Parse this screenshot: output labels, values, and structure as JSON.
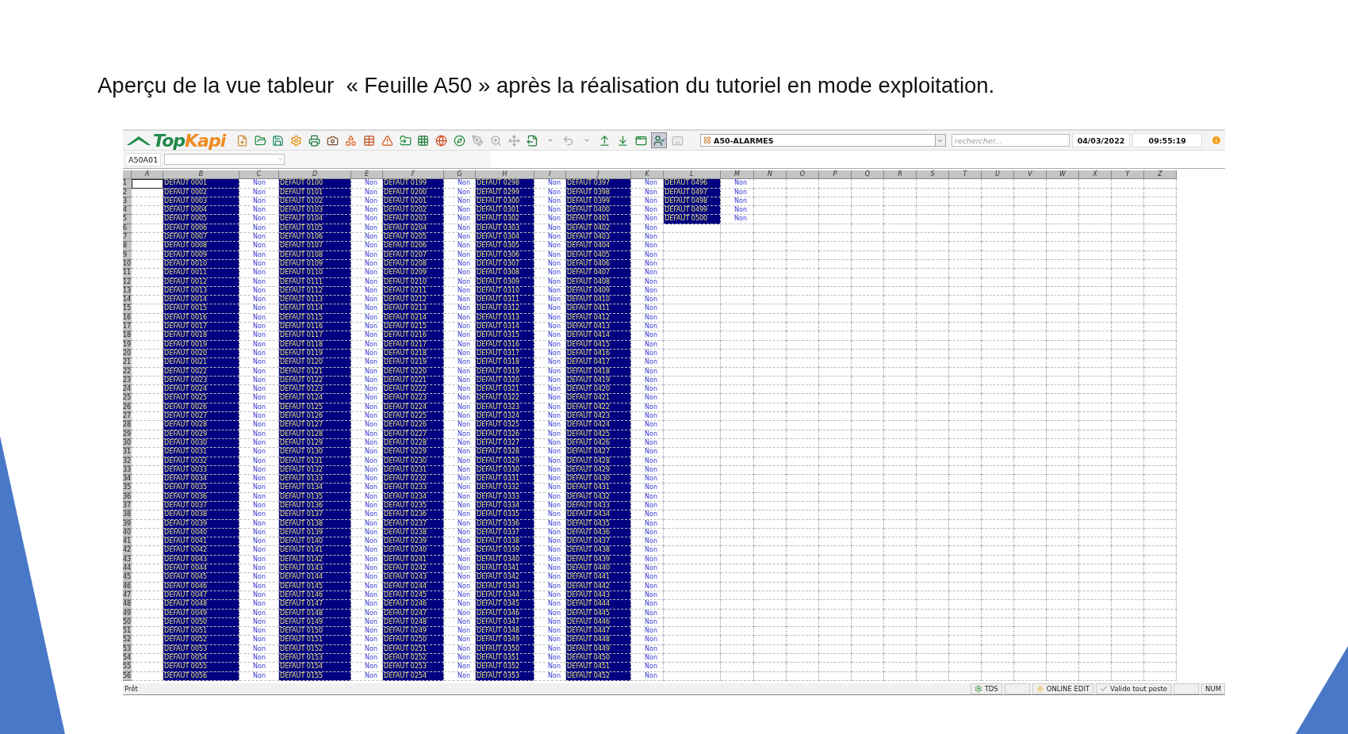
{
  "slide": {
    "caption": "Aperçu de la vue tableur  « Feuille A50 » après la réalisation du tutoriel en mode exploitation."
  },
  "app": {
    "logo": {
      "part_1": "Top",
      "part_2": "Kapi"
    },
    "view_select": "A50-ALARMES",
    "search": {
      "placeholder": "rechercher..."
    },
    "date": "04/03/2022",
    "time": "09:55:19",
    "name_box": "A50A01"
  },
  "sheet": {
    "columns": [
      {
        "label": "A"
      },
      {
        "label": "B",
        "kind": "alarm"
      },
      {
        "label": "C",
        "kind": "state"
      },
      {
        "label": "D",
        "kind": "alarm"
      },
      {
        "label": "E",
        "kind": "state"
      },
      {
        "label": "F",
        "kind": "alarm"
      },
      {
        "label": "G",
        "kind": "state"
      },
      {
        "label": "H",
        "kind": "alarm"
      },
      {
        "label": "I",
        "kind": "state"
      },
      {
        "label": "J",
        "kind": "alarm"
      },
      {
        "label": "K",
        "kind": "state"
      },
      {
        "label": "L",
        "kind": "alarm"
      },
      {
        "label": "M",
        "kind": "state"
      },
      {
        "label": "N"
      },
      {
        "label": "O"
      },
      {
        "label": "P"
      },
      {
        "label": "Q"
      },
      {
        "label": "R"
      },
      {
        "label": "S"
      },
      {
        "label": "T"
      },
      {
        "label": "U"
      },
      {
        "label": "V"
      },
      {
        "label": "W"
      },
      {
        "label": "X"
      },
      {
        "label": "Y"
      },
      {
        "label": "Z"
      }
    ],
    "rows": [
      {
        "n": "1",
        "selected": true,
        "cells": [
          "",
          "DEFAUT 0001",
          "Non",
          "DEFAUT 0100",
          "Non",
          "DEFAUT 0199",
          "Non",
          "DEFAUT 0298",
          "Non",
          "DEFAUT 0397",
          "Non",
          "DEFAUT 0496",
          "Non"
        ]
      },
      {
        "n": "2",
        "selected": false,
        "cells": [
          "",
          "DEFAUT 0002",
          "Non",
          "DEFAUT 0101",
          "Non",
          "DEFAUT 0200",
          "Non",
          "DEFAUT 0299",
          "Non",
          "DEFAUT 0398",
          "Non",
          "DEFAUT 0497",
          "Non"
        ]
      },
      {
        "n": "3",
        "selected": false,
        "cells": [
          "",
          "DEFAUT 0003",
          "Non",
          "DEFAUT 0102",
          "Non",
          "DEFAUT 0201",
          "Non",
          "DEFAUT 0300",
          "Non",
          "DEFAUT 0399",
          "Non",
          "DEFAUT 0498",
          "Non"
        ]
      },
      {
        "n": "4",
        "selected": false,
        "cells": [
          "",
          "DEFAUT 0004",
          "Non",
          "DEFAUT 0103",
          "Non",
          "DEFAUT 0202",
          "Non",
          "DEFAUT 0301",
          "Non",
          "DEFAUT 0400",
          "Non",
          "DEFAUT 0499",
          "Non"
        ]
      },
      {
        "n": "5",
        "selected": false,
        "cells": [
          "",
          "DEFAUT 0005",
          "Non",
          "DEFAUT 0104",
          "Non",
          "DEFAUT 0203",
          "Non",
          "DEFAUT 0302",
          "Non",
          "DEFAUT 0401",
          "Non",
          "DEFAUT 0500",
          "Non"
        ]
      },
      {
        "n": "6",
        "selected": false,
        "cells": [
          "",
          "DEFAUT 0006",
          "Non",
          "DEFAUT 0105",
          "Non",
          "DEFAUT 0204",
          "Non",
          "DEFAUT 0303",
          "Non",
          "DEFAUT 0402",
          "Non"
        ]
      },
      {
        "n": "7",
        "selected": false,
        "cells": [
          "",
          "DEFAUT 0007",
          "Non",
          "DEFAUT 0106",
          "Non",
          "DEFAUT 0205",
          "Non",
          "DEFAUT 0304",
          "Non",
          "DEFAUT 0403",
          "Non"
        ]
      },
      {
        "n": "8",
        "selected": false,
        "cells": [
          "",
          "DEFAUT 0008",
          "Non",
          "DEFAUT 0107",
          "Non",
          "DEFAUT 0206",
          "Non",
          "DEFAUT 0305",
          "Non",
          "DEFAUT 0404",
          "Non"
        ]
      },
      {
        "n": "9",
        "selected": false,
        "cells": [
          "",
          "DEFAUT 0009",
          "Non",
          "DEFAUT 0108",
          "Non",
          "DEFAUT 0207",
          "Non",
          "DEFAUT 0306",
          "Non",
          "DEFAUT 0405",
          "Non"
        ]
      },
      {
        "n": "10",
        "selected": false,
        "cells": [
          "",
          "DEFAUT 0010",
          "Non",
          "DEFAUT 0109",
          "Non",
          "DEFAUT 0208",
          "Non",
          "DEFAUT 0307",
          "Non",
          "DEFAUT 0406",
          "Non"
        ]
      },
      {
        "n": "11",
        "selected": false,
        "cells": [
          "",
          "DEFAUT 0011",
          "Non",
          "DEFAUT 0110",
          "Non",
          "DEFAUT 0209",
          "Non",
          "DEFAUT 0308",
          "Non",
          "DEFAUT 0407",
          "Non"
        ]
      },
      {
        "n": "12",
        "selected": false,
        "cells": [
          "",
          "DEFAUT 0012",
          "Non",
          "DEFAUT 0111",
          "Non",
          "DEFAUT 0210",
          "Non",
          "DEFAUT 0309",
          "Non",
          "DEFAUT 0408",
          "Non"
        ]
      },
      {
        "n": "13",
        "selected": false,
        "cells": [
          "",
          "DEFAUT 0013",
          "Non",
          "DEFAUT 0112",
          "Non",
          "DEFAUT 0211",
          "Non",
          "DEFAUT 0310",
          "Non",
          "DEFAUT 0409",
          "Non"
        ]
      },
      {
        "n": "14",
        "selected": false,
        "cells": [
          "",
          "DEFAUT 0014",
          "Non",
          "DEFAUT 0113",
          "Non",
          "DEFAUT 0212",
          "Non",
          "DEFAUT 0311",
          "Non",
          "DEFAUT 0410",
          "Non"
        ]
      },
      {
        "n": "15",
        "selected": false,
        "cells": [
          "",
          "DEFAUT 0015",
          "Non",
          "DEFAUT 0114",
          "Non",
          "DEFAUT 0213",
          "Non",
          "DEFAUT 0312",
          "Non",
          "DEFAUT 0411",
          "Non"
        ]
      },
      {
        "n": "16",
        "selected": false,
        "cells": [
          "",
          "DEFAUT 0016",
          "Non",
          "DEFAUT 0115",
          "Non",
          "DEFAUT 0214",
          "Non",
          "DEFAUT 0313",
          "Non",
          "DEFAUT 0412",
          "Non"
        ]
      },
      {
        "n": "17",
        "selected": false,
        "cells": [
          "",
          "DEFAUT 0017",
          "Non",
          "DEFAUT 0116",
          "Non",
          "DEFAUT 0215",
          "Non",
          "DEFAUT 0314",
          "Non",
          "DEFAUT 0413",
          "Non"
        ]
      },
      {
        "n": "18",
        "selected": false,
        "cells": [
          "",
          "DEFAUT 0018",
          "Non",
          "DEFAUT 0117",
          "Non",
          "DEFAUT 0216",
          "Non",
          "DEFAUT 0315",
          "Non",
          "DEFAUT 0414",
          "Non"
        ]
      },
      {
        "n": "19",
        "selected": false,
        "cells": [
          "",
          "DEFAUT 0019",
          "Non",
          "DEFAUT 0118",
          "Non",
          "DEFAUT 0217",
          "Non",
          "DEFAUT 0316",
          "Non",
          "DEFAUT 0415",
          "Non"
        ]
      },
      {
        "n": "20",
        "selected": false,
        "cells": [
          "",
          "DEFAUT 0020",
          "Non",
          "DEFAUT 0119",
          "Non",
          "DEFAUT 0218",
          "Non",
          "DEFAUT 0317",
          "Non",
          "DEFAUT 0416",
          "Non"
        ]
      },
      {
        "n": "21",
        "selected": false,
        "cells": [
          "",
          "DEFAUT 0021",
          "Non",
          "DEFAUT 0120",
          "Non",
          "DEFAUT 0219",
          "Non",
          "DEFAUT 0318",
          "Non",
          "DEFAUT 0417",
          "Non"
        ]
      },
      {
        "n": "22",
        "selected": false,
        "cells": [
          "",
          "DEFAUT 0022",
          "Non",
          "DEFAUT 0121",
          "Non",
          "DEFAUT 0220",
          "Non",
          "DEFAUT 0319",
          "Non",
          "DEFAUT 0418",
          "Non"
        ]
      },
      {
        "n": "23",
        "selected": false,
        "cells": [
          "",
          "DEFAUT 0023",
          "Non",
          "DEFAUT 0122",
          "Non",
          "DEFAUT 0221",
          "Non",
          "DEFAUT 0320",
          "Non",
          "DEFAUT 0419",
          "Non"
        ]
      },
      {
        "n": "24",
        "selected": false,
        "cells": [
          "",
          "DEFAUT 0024",
          "Non",
          "DEFAUT 0123",
          "Non",
          "DEFAUT 0222",
          "Non",
          "DEFAUT 0321",
          "Non",
          "DEFAUT 0420",
          "Non"
        ]
      },
      {
        "n": "25",
        "selected": false,
        "cells": [
          "",
          "DEFAUT 0025",
          "Non",
          "DEFAUT 0124",
          "Non",
          "DEFAUT 0223",
          "Non",
          "DEFAUT 0322",
          "Non",
          "DEFAUT 0421",
          "Non"
        ]
      },
      {
        "n": "26",
        "selected": false,
        "cells": [
          "",
          "DEFAUT 0026",
          "Non",
          "DEFAUT 0125",
          "Non",
          "DEFAUT 0224",
          "Non",
          "DEFAUT 0323",
          "Non",
          "DEFAUT 0422",
          "Non"
        ]
      },
      {
        "n": "27",
        "selected": false,
        "cells": [
          "",
          "DEFAUT 0027",
          "Non",
          "DEFAUT 0126",
          "Non",
          "DEFAUT 0225",
          "Non",
          "DEFAUT 0324",
          "Non",
          "DEFAUT 0423",
          "Non"
        ]
      },
      {
        "n": "28",
        "selected": false,
        "cells": [
          "",
          "DEFAUT 0028",
          "Non",
          "DEFAUT 0127",
          "Non",
          "DEFAUT 0226",
          "Non",
          "DEFAUT 0325",
          "Non",
          "DEFAUT 0424",
          "Non"
        ]
      },
      {
        "n": "29",
        "selected": false,
        "cells": [
          "",
          "DEFAUT 0029",
          "Non",
          "DEFAUT 0128",
          "Non",
          "DEFAUT 0227",
          "Non",
          "DEFAUT 0326",
          "Non",
          "DEFAUT 0425",
          "Non"
        ]
      },
      {
        "n": "30",
        "selected": false,
        "cells": [
          "",
          "DEFAUT 0030",
          "Non",
          "DEFAUT 0129",
          "Non",
          "DEFAUT 0228",
          "Non",
          "DEFAUT 0327",
          "Non",
          "DEFAUT 0426",
          "Non"
        ]
      },
      {
        "n": "31",
        "selected": false,
        "cells": [
          "",
          "DEFAUT 0031",
          "Non",
          "DEFAUT 0130",
          "Non",
          "DEFAUT 0229",
          "Non",
          "DEFAUT 0328",
          "Non",
          "DEFAUT 0427",
          "Non"
        ]
      },
      {
        "n": "32",
        "selected": false,
        "cells": [
          "",
          "DEFAUT 0032",
          "Non",
          "DEFAUT 0131",
          "Non",
          "DEFAUT 0230",
          "Non",
          "DEFAUT 0329",
          "Non",
          "DEFAUT 0428",
          "Non"
        ]
      },
      {
        "n": "33",
        "selected": false,
        "cells": [
          "",
          "DEFAUT 0033",
          "Non",
          "DEFAUT 0132",
          "Non",
          "DEFAUT 0231",
          "Non",
          "DEFAUT 0330",
          "Non",
          "DEFAUT 0429",
          "Non"
        ]
      },
      {
        "n": "34",
        "selected": false,
        "cells": [
          "",
          "DEFAUT 0034",
          "Non",
          "DEFAUT 0133",
          "Non",
          "DEFAUT 0232",
          "Non",
          "DEFAUT 0331",
          "Non",
          "DEFAUT 0430",
          "Non"
        ]
      },
      {
        "n": "35",
        "selected": false,
        "cells": [
          "",
          "DEFAUT 0035",
          "Non",
          "DEFAUT 0134",
          "Non",
          "DEFAUT 0233",
          "Non",
          "DEFAUT 0332",
          "Non",
          "DEFAUT 0431",
          "Non"
        ]
      },
      {
        "n": "36",
        "selected": false,
        "cells": [
          "",
          "DEFAUT 0036",
          "Non",
          "DEFAUT 0135",
          "Non",
          "DEFAUT 0234",
          "Non",
          "DEFAUT 0333",
          "Non",
          "DEFAUT 0432",
          "Non"
        ]
      },
      {
        "n": "37",
        "selected": false,
        "cells": [
          "",
          "DEFAUT 0037",
          "Non",
          "DEFAUT 0136",
          "Non",
          "DEFAUT 0235",
          "Non",
          "DEFAUT 0334",
          "Non",
          "DEFAUT 0433",
          "Non"
        ]
      },
      {
        "n": "38",
        "selected": false,
        "cells": [
          "",
          "DEFAUT 0038",
          "Non",
          "DEFAUT 0137",
          "Non",
          "DEFAUT 0236",
          "Non",
          "DEFAUT 0335",
          "Non",
          "DEFAUT 0434",
          "Non"
        ]
      },
      {
        "n": "39",
        "selected": false,
        "cells": [
          "",
          "DEFAUT 0039",
          "Non",
          "DEFAUT 0138",
          "Non",
          "DEFAUT 0237",
          "Non",
          "DEFAUT 0336",
          "Non",
          "DEFAUT 0435",
          "Non"
        ]
      },
      {
        "n": "40",
        "selected": false,
        "cells": [
          "",
          "DEFAUT 0040",
          "Non",
          "DEFAUT 0139",
          "Non",
          "DEFAUT 0238",
          "Non",
          "DEFAUT 0337",
          "Non",
          "DEFAUT 0436",
          "Non"
        ]
      },
      {
        "n": "41",
        "selected": false,
        "cells": [
          "",
          "DEFAUT 0041",
          "Non",
          "DEFAUT 0140",
          "Non",
          "DEFAUT 0239",
          "Non",
          "DEFAUT 0338",
          "Non",
          "DEFAUT 0437",
          "Non"
        ]
      },
      {
        "n": "42",
        "selected": false,
        "cells": [
          "",
          "DEFAUT 0042",
          "Non",
          "DEFAUT 0141",
          "Non",
          "DEFAUT 0240",
          "Non",
          "DEFAUT 0339",
          "Non",
          "DEFAUT 0438",
          "Non"
        ]
      },
      {
        "n": "43",
        "selected": false,
        "cells": [
          "",
          "DEFAUT 0043",
          "Non",
          "DEFAUT 0142",
          "Non",
          "DEFAUT 0241",
          "Non",
          "DEFAUT 0340",
          "Non",
          "DEFAUT 0439",
          "Non"
        ]
      },
      {
        "n": "44",
        "selected": false,
        "cells": [
          "",
          "DEFAUT 0044",
          "Non",
          "DEFAUT 0143",
          "Non",
          "DEFAUT 0242",
          "Non",
          "DEFAUT 0341",
          "Non",
          "DEFAUT 0440",
          "Non"
        ]
      },
      {
        "n": "45",
        "selected": false,
        "cells": [
          "",
          "DEFAUT 0045",
          "Non",
          "DEFAUT 0144",
          "Non",
          "DEFAUT 0243",
          "Non",
          "DEFAUT 0342",
          "Non",
          "DEFAUT 0441",
          "Non"
        ]
      },
      {
        "n": "46",
        "selected": false,
        "cells": [
          "",
          "DEFAUT 0046",
          "Non",
          "DEFAUT 0145",
          "Non",
          "DEFAUT 0244",
          "Non",
          "DEFAUT 0343",
          "Non",
          "DEFAUT 0442",
          "Non"
        ]
      },
      {
        "n": "47",
        "selected": false,
        "cells": [
          "",
          "DEFAUT 0047",
          "Non",
          "DEFAUT 0146",
          "Non",
          "DEFAUT 0245",
          "Non",
          "DEFAUT 0344",
          "Non",
          "DEFAUT 0443",
          "Non"
        ]
      },
      {
        "n": "48",
        "selected": false,
        "cells": [
          "",
          "DEFAUT 0048",
          "Non",
          "DEFAUT 0147",
          "Non",
          "DEFAUT 0246",
          "Non",
          "DEFAUT 0345",
          "Non",
          "DEFAUT 0444",
          "Non"
        ]
      },
      {
        "n": "49",
        "selected": false,
        "cells": [
          "",
          "DEFAUT 0049",
          "Non",
          "DEFAUT 0148",
          "Non",
          "DEFAUT 0247",
          "Non",
          "DEFAUT 0346",
          "Non",
          "DEFAUT 0445",
          "Non"
        ]
      },
      {
        "n": "50",
        "selected": false,
        "cells": [
          "",
          "DEFAUT 0050",
          "Non",
          "DEFAUT 0149",
          "Non",
          "DEFAUT 0248",
          "Non",
          "DEFAUT 0347",
          "Non",
          "DEFAUT 0446",
          "Non"
        ]
      },
      {
        "n": "51",
        "selected": false,
        "cells": [
          "",
          "DEFAUT 0051",
          "Non",
          "DEFAUT 0150",
          "Non",
          "DEFAUT 0249",
          "Non",
          "DEFAUT 0348",
          "Non",
          "DEFAUT 0447",
          "Non"
        ]
      },
      {
        "n": "52",
        "selected": false,
        "cells": [
          "",
          "DEFAUT 0052",
          "Non",
          "DEFAUT 0151",
          "Non",
          "DEFAUT 0250",
          "Non",
          "DEFAUT 0349",
          "Non",
          "DEFAUT 0448",
          "Non"
        ]
      },
      {
        "n": "53",
        "selected": false,
        "cells": [
          "",
          "DEFAUT 0053",
          "Non",
          "DEFAUT 0152",
          "Non",
          "DEFAUT 0251",
          "Non",
          "DEFAUT 0350",
          "Non",
          "DEFAUT 0449",
          "Non"
        ]
      },
      {
        "n": "54",
        "selected": false,
        "cells": [
          "",
          "DEFAUT 0054",
          "Non",
          "DEFAUT 0153",
          "Non",
          "DEFAUT 0252",
          "Non",
          "DEFAUT 0351",
          "Non",
          "DEFAUT 0450",
          "Non"
        ]
      },
      {
        "n": "55",
        "selected": false,
        "cells": [
          "",
          "DEFAUT 0055",
          "Non",
          "DEFAUT 0154",
          "Non",
          "DEFAUT 0253",
          "Non",
          "DEFAUT 0352",
          "Non",
          "DEFAUT 0451",
          "Non"
        ]
      },
      {
        "n": "56",
        "selected": false,
        "cells": [
          "",
          "DEFAUT 0056",
          "Non",
          "DEFAUT 0155",
          "Non",
          "DEFAUT 0254",
          "Non",
          "DEFAUT 0353",
          "Non",
          "DEFAUT 0452",
          "Non"
        ]
      }
    ]
  },
  "status_bar": {
    "status": "Prêt",
    "items": [
      {
        "kind": "gear",
        "label": "TDS"
      },
      {
        "kind": "blank"
      },
      {
        "kind": "sun",
        "label": "ONLINE EDIT"
      },
      {
        "kind": "check",
        "label": "Valide tout poste"
      },
      {
        "kind": "blank"
      },
      {
        "kind": "text",
        "label": "NUM"
      }
    ]
  }
}
